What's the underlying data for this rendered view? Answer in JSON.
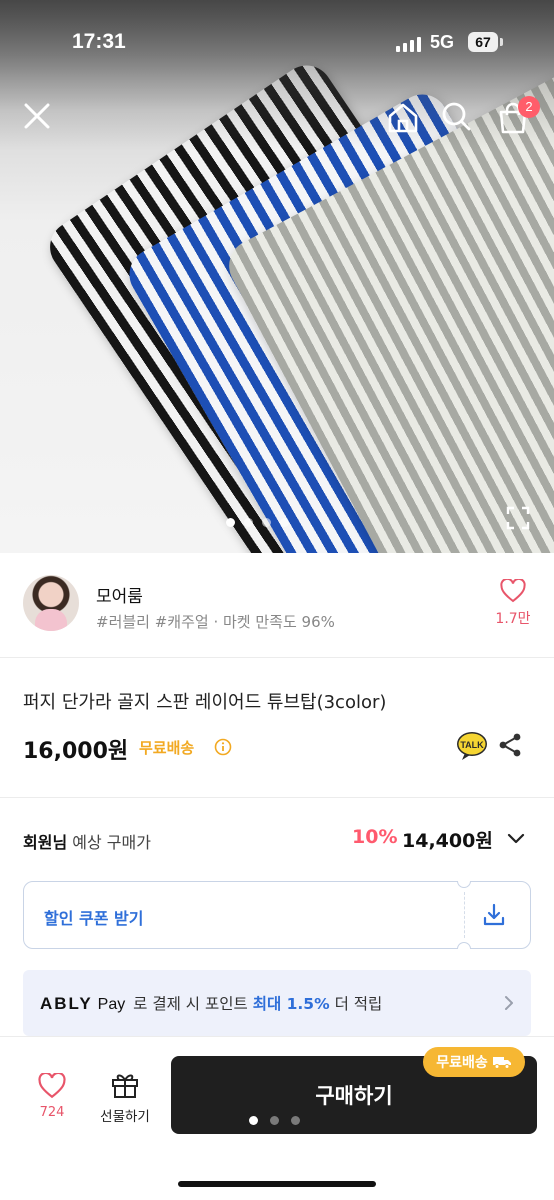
{
  "status_bar": {
    "time": "17:31",
    "network": "5G",
    "battery": "67"
  },
  "header": {
    "icons": [
      "close-icon",
      "home-icon",
      "search-icon",
      "shopping-bag-icon"
    ],
    "cart_badge": "2",
    "image_dots": {
      "count": 4,
      "active_index": 0
    }
  },
  "seller": {
    "name": "모어룸",
    "tags": "#러블리 #캐주얼 · 마켓 만족도 96%",
    "like_count": "1.7만"
  },
  "product": {
    "title": "퍼지 단가라 골지 스판 레이어드 튜브탑(3color)",
    "price": "16,000원",
    "shipping": "무료배송"
  },
  "member_price": {
    "label_bold": "회원님",
    "label": "예상 구매가",
    "discount": "10%",
    "price": "14,400원"
  },
  "coupon": {
    "label": "할인 쿠폰 받기"
  },
  "ably_pay": {
    "logo": "ABLY",
    "logo_sub": "Pay",
    "text_before": "로 결제 시 포인트",
    "highlight": "최대 1.5%",
    "text_after": "더 적립"
  },
  "bottom_bar": {
    "like_count": "724",
    "gift_label": "선물하기",
    "buy_label": "구매하기",
    "free_shipping_badge": "무료배송",
    "page_dots": {
      "count": 3,
      "active_index": 0
    }
  },
  "colors": {
    "accent_pink": "#e8556a",
    "discount_red": "#ff5a6e",
    "shipping_orange": "#f2a922",
    "link_blue": "#2f6fd9",
    "buy_button": "#1f1f1f",
    "badge_yellow": "#f6b733"
  }
}
